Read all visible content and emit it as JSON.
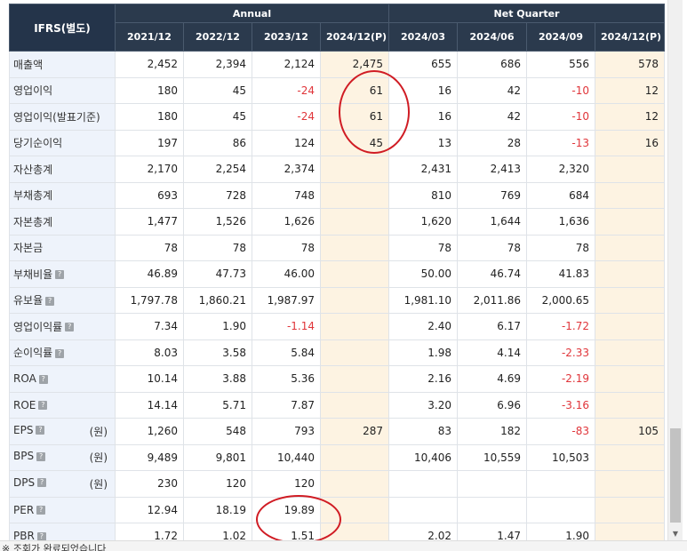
{
  "header": {
    "corner": "IFRS(별도)",
    "group_annual": "Annual",
    "group_quarter": "Net Quarter",
    "periods": [
      "2021/12",
      "2022/12",
      "2023/12",
      "2024/12(P)",
      "2024/03",
      "2024/06",
      "2024/09",
      "2024/12(P)"
    ]
  },
  "rows": [
    {
      "label": "매출액",
      "unit": "",
      "help": false,
      "values": [
        "2,452",
        "2,394",
        "2,124",
        "2,475",
        "655",
        "686",
        "556",
        "578"
      ]
    },
    {
      "label": "영업이익",
      "unit": "",
      "help": false,
      "values": [
        "180",
        "45",
        "-24",
        "61",
        "16",
        "42",
        "-10",
        "12"
      ]
    },
    {
      "label": "영업이익(발표기준)",
      "unit": "",
      "help": false,
      "values": [
        "180",
        "45",
        "-24",
        "61",
        "16",
        "42",
        "-10",
        "12"
      ]
    },
    {
      "label": "당기순이익",
      "unit": "",
      "help": false,
      "values": [
        "197",
        "86",
        "124",
        "45",
        "13",
        "28",
        "-13",
        "16"
      ]
    },
    {
      "label": "자산총계",
      "unit": "",
      "help": false,
      "values": [
        "2,170",
        "2,254",
        "2,374",
        "",
        "2,431",
        "2,413",
        "2,320",
        ""
      ]
    },
    {
      "label": "부채총계",
      "unit": "",
      "help": false,
      "values": [
        "693",
        "728",
        "748",
        "",
        "810",
        "769",
        "684",
        ""
      ]
    },
    {
      "label": "자본총계",
      "unit": "",
      "help": false,
      "values": [
        "1,477",
        "1,526",
        "1,626",
        "",
        "1,620",
        "1,644",
        "1,636",
        ""
      ]
    },
    {
      "label": "자본금",
      "unit": "",
      "help": false,
      "values": [
        "78",
        "78",
        "78",
        "",
        "78",
        "78",
        "78",
        ""
      ]
    },
    {
      "label": "부채비율",
      "unit": "",
      "help": true,
      "values": [
        "46.89",
        "47.73",
        "46.00",
        "",
        "50.00",
        "46.74",
        "41.83",
        ""
      ]
    },
    {
      "label": "유보율",
      "unit": "",
      "help": true,
      "values": [
        "1,797.78",
        "1,860.21",
        "1,987.97",
        "",
        "1,981.10",
        "2,011.86",
        "2,000.65",
        ""
      ]
    },
    {
      "label": "영업이익률",
      "unit": "",
      "help": true,
      "values": [
        "7.34",
        "1.90",
        "-1.14",
        "",
        "2.40",
        "6.17",
        "-1.72",
        ""
      ]
    },
    {
      "label": "순이익률",
      "unit": "",
      "help": true,
      "values": [
        "8.03",
        "3.58",
        "5.84",
        "",
        "1.98",
        "4.14",
        "-2.33",
        ""
      ]
    },
    {
      "label": "ROA",
      "unit": "",
      "help": true,
      "values": [
        "10.14",
        "3.88",
        "5.36",
        "",
        "2.16",
        "4.69",
        "-2.19",
        ""
      ]
    },
    {
      "label": "ROE",
      "unit": "",
      "help": true,
      "values": [
        "14.14",
        "5.71",
        "7.87",
        "",
        "3.20",
        "6.96",
        "-3.16",
        ""
      ]
    },
    {
      "label": "EPS",
      "unit": "(원)",
      "help": true,
      "values": [
        "1,260",
        "548",
        "793",
        "287",
        "83",
        "182",
        "-83",
        "105"
      ]
    },
    {
      "label": "BPS",
      "unit": "(원)",
      "help": true,
      "values": [
        "9,489",
        "9,801",
        "10,440",
        "",
        "10,406",
        "10,559",
        "10,503",
        ""
      ]
    },
    {
      "label": "DPS",
      "unit": "(원)",
      "help": true,
      "values": [
        "230",
        "120",
        "120",
        "",
        "",
        "",
        "",
        ""
      ]
    },
    {
      "label": "PER",
      "unit": "",
      "help": true,
      "values": [
        "12.94",
        "18.19",
        "19.89",
        "",
        "",
        "",
        "",
        ""
      ]
    },
    {
      "label": "PBR",
      "unit": "",
      "help": true,
      "values": [
        "1.72",
        "1.02",
        "1.51",
        "",
        "2.02",
        "1.47",
        "1.90",
        ""
      ]
    }
  ],
  "footnote": "※ 조회가 완료되었습니다",
  "colors": {
    "header_bg": "#2b3a4d",
    "label_bg": "#eef3fb",
    "forecast_bg": "#fdf3e2",
    "negative": "#e0353a",
    "annotation": "#d01c24"
  }
}
